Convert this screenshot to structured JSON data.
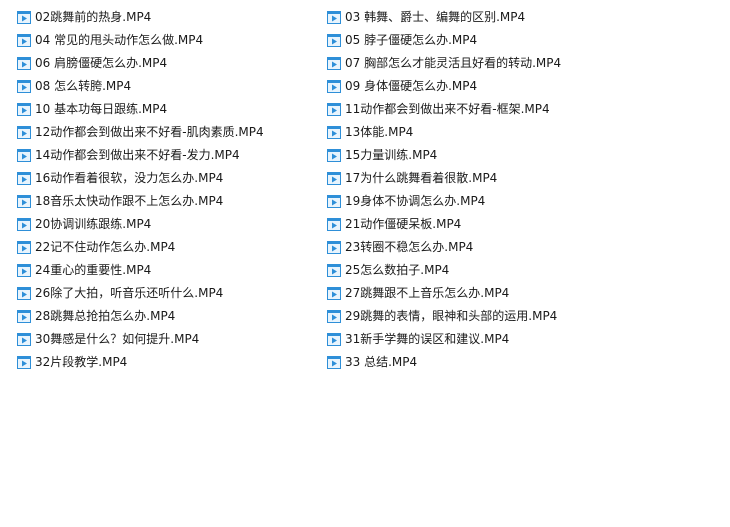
{
  "files_left": [
    {
      "name": "02跳舞前的热身.MP4",
      "icon": "video-file-icon"
    },
    {
      "name": "04 常见的甩头动作怎么做.MP4",
      "icon": "video-file-icon"
    },
    {
      "name": "06 肩膀僵硬怎么办.MP4",
      "icon": "video-file-icon"
    },
    {
      "name": "08 怎么转胯.MP4",
      "icon": "video-file-icon"
    },
    {
      "name": "10 基本功每日跟练.MP4",
      "icon": "video-file-icon"
    },
    {
      "name": "12动作都会到做出来不好看-肌肉素质.MP4",
      "icon": "video-file-icon"
    },
    {
      "name": "14动作都会到做出来不好看-发力.MP4",
      "icon": "video-file-icon"
    },
    {
      "name": "16动作看着很软，没力怎么办.MP4",
      "icon": "video-file-icon"
    },
    {
      "name": "18音乐太快动作跟不上怎么办.MP4",
      "icon": "video-file-icon"
    },
    {
      "name": "20协调训练跟练.MP4",
      "icon": "video-file-icon"
    },
    {
      "name": "22记不住动作怎么办.MP4",
      "icon": "video-file-icon"
    },
    {
      "name": "24重心的重要性.MP4",
      "icon": "video-file-icon"
    },
    {
      "name": "26除了大拍，听音乐还听什么.MP4",
      "icon": "video-file-icon"
    },
    {
      "name": "28跳舞总抢拍怎么办.MP4",
      "icon": "video-file-icon"
    },
    {
      "name": "30舞感是什么？如何提升.MP4",
      "icon": "video-file-icon"
    },
    {
      "name": "32片段教学.MP4",
      "icon": "video-file-icon"
    }
  ],
  "files_right": [
    {
      "name": "03 韩舞、爵士、编舞的区别.MP4",
      "icon": "video-file-icon"
    },
    {
      "name": "05 脖子僵硬怎么办.MP4",
      "icon": "video-file-icon"
    },
    {
      "name": "07 胸部怎么才能灵活且好看的转动.MP4",
      "icon": "video-file-icon"
    },
    {
      "name": "09 身体僵硬怎么办.MP4",
      "icon": "video-file-icon"
    },
    {
      "name": "11动作都会到做出来不好看-框架.MP4",
      "icon": "video-file-icon"
    },
    {
      "name": "13体能.MP4",
      "icon": "video-file-icon"
    },
    {
      "name": "15力量训练.MP4",
      "icon": "video-file-icon"
    },
    {
      "name": "17为什么跳舞看着很散.MP4",
      "icon": "video-file-icon"
    },
    {
      "name": "19身体不协调怎么办.MP4",
      "icon": "video-file-icon"
    },
    {
      "name": "21动作僵硬呆板.MP4",
      "icon": "video-file-icon"
    },
    {
      "name": "23转圈不稳怎么办.MP4",
      "icon": "video-file-icon"
    },
    {
      "name": "25怎么数拍子.MP4",
      "icon": "video-file-icon"
    },
    {
      "name": "27跳舞跟不上音乐怎么办.MP4",
      "icon": "video-file-icon"
    },
    {
      "name": "29跳舞的表情，眼神和头部的运用.MP4",
      "icon": "video-file-icon"
    },
    {
      "name": "31新手学舞的误区和建议.MP4",
      "icon": "video-file-icon"
    },
    {
      "name": "33 总结.MP4",
      "icon": "video-file-icon"
    }
  ],
  "colors": {
    "icon_frame": "#2e8fd8",
    "icon_fill": "#e8f4fd",
    "icon_play": "#2e8fd8",
    "text": "#1a1a1a"
  }
}
